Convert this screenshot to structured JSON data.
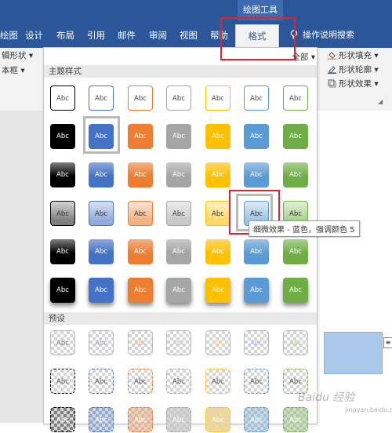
{
  "ribbon_tabs": {
    "context_label": "绘图工具",
    "tabs": [
      "绘图",
      "设计",
      "布局",
      "引用",
      "邮件",
      "审阅",
      "视图",
      "帮助"
    ],
    "active": "格式",
    "tell_me": "操作说明搜索"
  },
  "ribbon_left": {
    "edit_shape": "辑形状",
    "text_box": "本框"
  },
  "ribbon_right": {
    "fill": "形状填充",
    "outline": "形状轮廓",
    "effects": "形状效果"
  },
  "gallery": {
    "filter": "全部",
    "theme_section": "主题样式",
    "preset_section": "预设",
    "swatch_label": "Abc",
    "colors": [
      "#000000",
      "#4472c4",
      "#ed7d31",
      "#a5a5a5",
      "#ffc000",
      "#5b9bd5",
      "#70ad47"
    ],
    "light_colors": [
      "#7f7f7f",
      "#8faadc",
      "#f4b183",
      "#c9c9c9",
      "#ffd966",
      "#9dc3e6",
      "#a9d18e"
    ]
  },
  "tooltip": "细微效果 - 蓝色，强调颜色 5",
  "watermark": {
    "text": "Baidu 经验",
    "sub": "jingyan.baidu.com"
  },
  "colors": {
    "ribbon_blue": "#2b579a",
    "highlight_red": "#e8202a"
  }
}
